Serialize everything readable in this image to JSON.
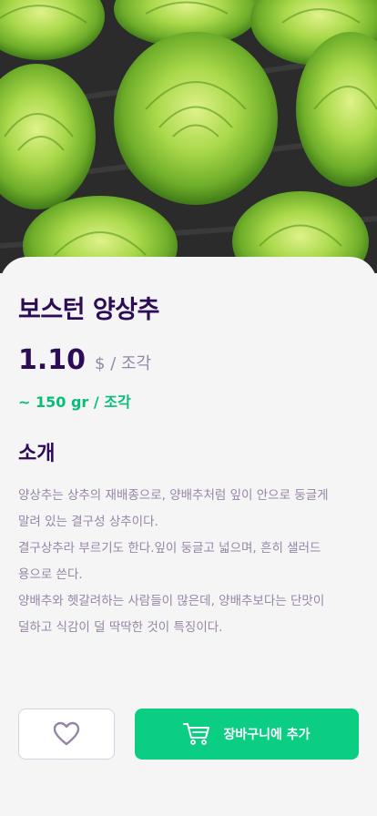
{
  "hero": {
    "image_subject": "boston lettuce heads on dark soil",
    "colors": {
      "leaf_light": "#c6e86a",
      "leaf_mid": "#8fc83a",
      "leaf_dark": "#4f8f1c",
      "soil": "#2b2b2b"
    }
  },
  "product": {
    "title": "보스턴 양상추",
    "price": "1.10",
    "price_unit": "$ / 조각",
    "weight": "~ 150 gr / 조각"
  },
  "description_section": {
    "title": "소개",
    "lines": [
      "양상추는 상추의 재배종으로, 양배추처럼 잎이 안으로 둥글게",
      "말려 있는 결구성 상추이다.",
      "결구상추라 부르기도 한다.잎이 둥글고 넓으며, 흔히 샐러드",
      "용으로 쓴다.",
      "양배추와 헷갈려하는 사람들이 많은데, 양배추보다는 단맛이",
      "덜하고 식감이 덜 딱딱한 것이 특징이다."
    ]
  },
  "actions": {
    "favorite_icon": "heart-icon",
    "cart_icon": "cart-icon",
    "add_to_cart_label": "장바구니에 추가"
  },
  "colors": {
    "title": "#2d0c57",
    "muted": "#9586a8",
    "accent_green": "#0bce83",
    "weight_green": "#06be77",
    "background": "#f6f5f5"
  }
}
